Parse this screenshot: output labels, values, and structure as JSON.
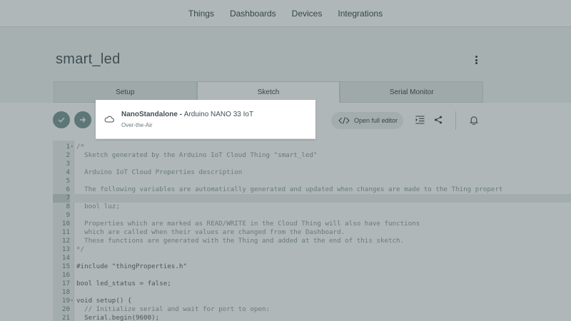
{
  "nav": {
    "items": [
      "Things",
      "Dashboards",
      "Devices",
      "Integrations"
    ]
  },
  "thing": {
    "title": "smart_led"
  },
  "tabs": {
    "items": [
      "Setup",
      "Sketch",
      "Serial Monitor"
    ],
    "active": "Sketch"
  },
  "toolbar": {
    "open_editor_label": "Open full editor"
  },
  "popup": {
    "device_name": "NanoStandalone",
    "device_sep": " - ",
    "board": "Arduino NANO 33 IoT",
    "upload_method": "Over-the-Air"
  },
  "editor": {
    "current_line": 7,
    "lines": [
      {
        "n": "1",
        "fold": true,
        "text": "/*"
      },
      {
        "n": "2",
        "text": "  Sketch generated by the Arduino IoT Cloud Thing \"smart_led\""
      },
      {
        "n": "3",
        "text": ""
      },
      {
        "n": "4",
        "text": "  Arduino IoT Cloud Properties description"
      },
      {
        "n": "5",
        "text": ""
      },
      {
        "n": "6",
        "text": "  The following variables are automatically generated and updated when changes are made to the Thing propert"
      },
      {
        "n": "7",
        "text": ""
      },
      {
        "n": "8",
        "text": "  bool luz;"
      },
      {
        "n": "9",
        "text": ""
      },
      {
        "n": "10",
        "text": "  Properties which are marked as READ/WRITE in the Cloud Thing will also have functions"
      },
      {
        "n": "11",
        "text": "  which are called when their values are changed from the Dashboard."
      },
      {
        "n": "12",
        "text": "  These functions are generated with the Thing and added at the end of this sketch."
      },
      {
        "n": "13",
        "text": "*/"
      },
      {
        "n": "14",
        "text": ""
      },
      {
        "n": "15",
        "text": "#include \"thingProperties.h\"",
        "kw": true
      },
      {
        "n": "16",
        "text": ""
      },
      {
        "n": "17",
        "text": "bool led_status = false;",
        "kw": true
      },
      {
        "n": "18",
        "text": ""
      },
      {
        "n": "19",
        "fold": true,
        "text": "void setup() {",
        "kw": true
      },
      {
        "n": "20",
        "text": "  // Initialize serial and wait for port to open:"
      },
      {
        "n": "21",
        "text": "  Serial.begin(9600);",
        "kw": true
      }
    ]
  },
  "icons": {
    "verify": "checkmark-icon",
    "upload": "arrow-right-icon",
    "code": "code-brackets-icon",
    "indent": "indent-icon",
    "share": "share-icon",
    "bell": "bell-icon",
    "cloud": "cloud-icon",
    "menu": "kebab-menu-icon"
  }
}
